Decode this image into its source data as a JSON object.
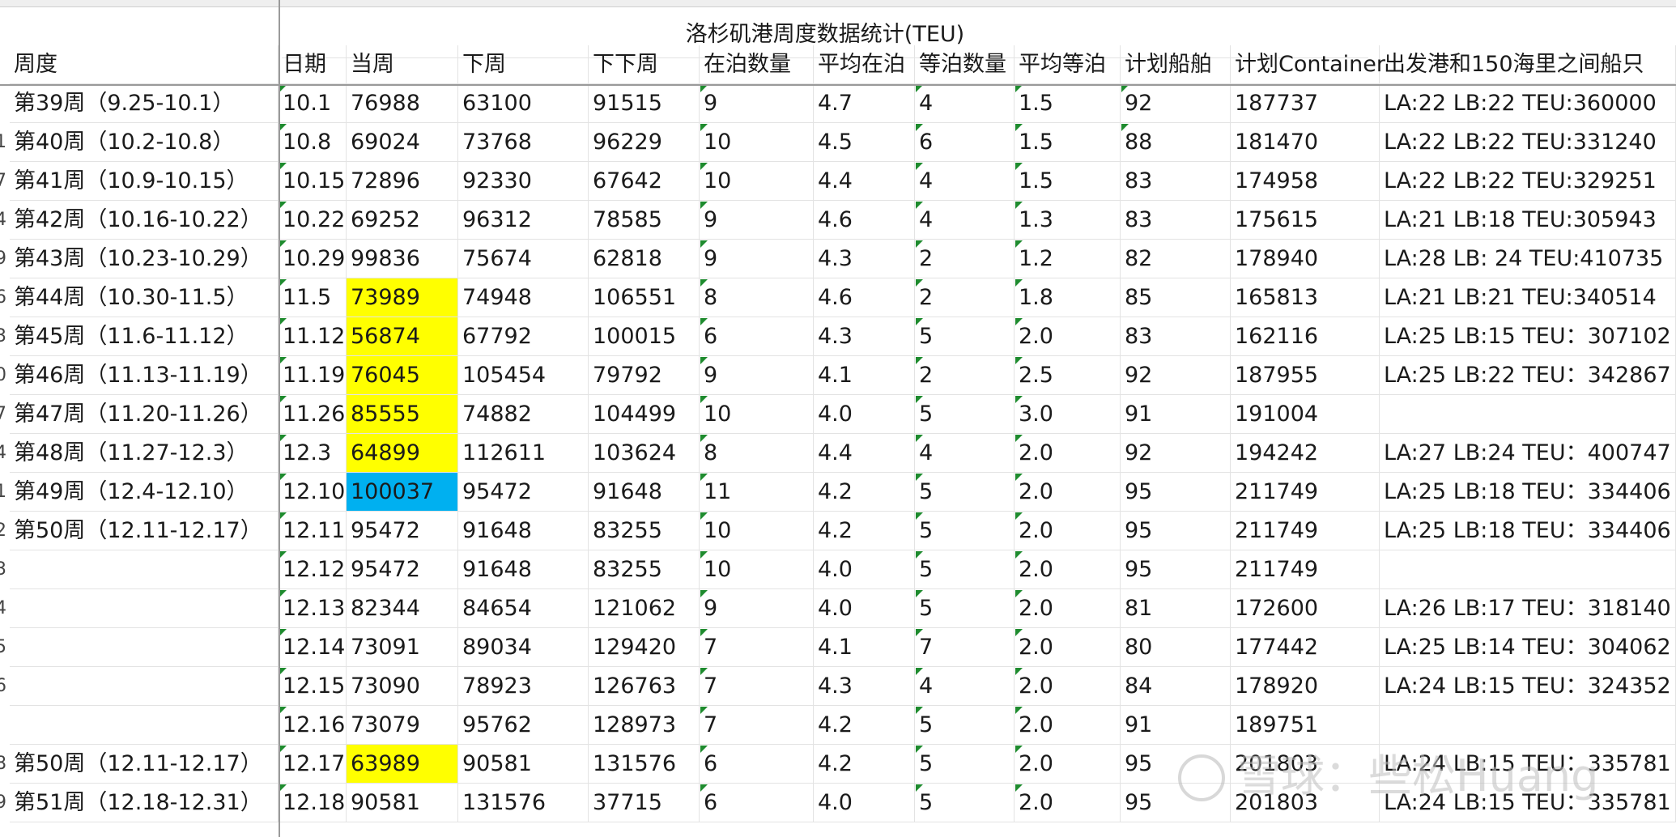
{
  "sheet": {
    "title": "洛杉矶港周度数据统计(TEU)",
    "headers": [
      "周度",
      "日期",
      "当周",
      "下周",
      "下下周",
      "在泊数量",
      "平均在泊",
      "等泊数量",
      "平均等泊",
      "计划船舶",
      "计划Container",
      "出发港和150海里之间船只"
    ],
    "row_number_stubs": [
      "",
      "1",
      "7",
      "4",
      "9",
      "6",
      "3",
      "0",
      "7",
      "4",
      "1",
      "2",
      "3",
      "4",
      "5",
      "6",
      "",
      "8",
      "9"
    ],
    "rows": [
      [
        "第39周（9.25-10.1）",
        "10.1",
        "76988",
        "63100",
        "91515",
        "9",
        "4.7",
        "4",
        "1.5",
        "92",
        "187737",
        "LA:22  LB:22  TEU:360000"
      ],
      [
        "第40周（10.2-10.8）",
        "10.8",
        "69024",
        "73768",
        "96229",
        "10",
        "4.5",
        "6",
        "1.5",
        "88",
        "181470",
        "LA:22  LB:22  TEU:331240"
      ],
      [
        "第41周（10.9-10.15）",
        "10.15",
        "72896",
        "92330",
        "67642",
        "10",
        "4.4",
        "4",
        "1.5",
        "83",
        "174958",
        "LA:22  LB:22  TEU:329251"
      ],
      [
        "第42周（10.16-10.22）",
        "10.22",
        "69252",
        "96312",
        "78585",
        "9",
        "4.6",
        "4",
        "1.3",
        "83",
        "175615",
        "LA:21 LB:18  TEU:305943"
      ],
      [
        "第43周（10.23-10.29）",
        "10.29",
        "99836",
        "75674",
        "62818",
        "9",
        "4.3",
        "2",
        "1.2",
        "82",
        "178940",
        "LA:28  LB: 24  TEU:410735"
      ],
      [
        "第44周（10.30-11.5）",
        "11.5",
        "73989",
        "74948",
        "106551",
        "8",
        "4.6",
        "2",
        "1.8",
        "85",
        "165813",
        "LA:21  LB:21  TEU:340514"
      ],
      [
        "第45周（11.6-11.12）",
        "11.12",
        "56874",
        "67792",
        "100015",
        "6",
        "4.3",
        "5",
        "2.0",
        "83",
        "162116",
        "LA:25 LB:15 TEU：307102"
      ],
      [
        "第46周（11.13-11.19）",
        "11.19",
        "76045",
        "105454",
        "79792",
        "9",
        "4.1",
        "2",
        "2.5",
        "92",
        "187955",
        "LA:25 LB:22 TEU：342867"
      ],
      [
        "第47周（11.20-11.26）",
        "11.26",
        "85555",
        "74882",
        "104499",
        "10",
        "4.0",
        "5",
        "3.0",
        "91",
        "191004",
        ""
      ],
      [
        "第48周（11.27-12.3）",
        "12.3",
        "64899",
        "112611",
        "103624",
        "8",
        "4.4",
        "4",
        "2.0",
        "92",
        "194242",
        "LA:27 LB:24 TEU：400747"
      ],
      [
        "第49周（12.4-12.10）",
        "12.10",
        "100037",
        "95472",
        "91648",
        "11",
        "4.2",
        "5",
        "2.0",
        "95",
        "211749",
        "LA:25 LB:18 TEU：334406"
      ],
      [
        "第50周（12.11-12.17）",
        "12.11",
        "95472",
        "91648",
        "83255",
        "10",
        "4.2",
        "5",
        "2.0",
        "95",
        "211749",
        "LA:25 LB:18 TEU：334406"
      ],
      [
        "",
        "12.12",
        "95472",
        "91648",
        "83255",
        "10",
        "4.0",
        "5",
        "2.0",
        "95",
        "211749",
        ""
      ],
      [
        "",
        "12.13",
        "82344",
        "84654",
        "121062",
        "9",
        "4.0",
        "5",
        "2.0",
        "81",
        "172600",
        "LA:26 LB:17 TEU：318140"
      ],
      [
        "",
        "12.14",
        "73091",
        "89034",
        "129420",
        "7",
        "4.1",
        "7",
        "2.0",
        "80",
        "177442",
        "LA:25 LB:14 TEU：304062"
      ],
      [
        "",
        "12.15",
        "73090",
        "78923",
        "126763",
        "7",
        "4.3",
        "4",
        "2.0",
        "84",
        "178920",
        "LA:24 LB:15 TEU：324352"
      ],
      [
        "",
        "12.16",
        "73079",
        "95762",
        "128973",
        "7",
        "4.2",
        "5",
        "2.0",
        "91",
        "189751",
        ""
      ],
      [
        "第50周（12.11-12.17）",
        "12.17",
        "63989",
        "90581",
        "131576",
        "6",
        "4.2",
        "5",
        "2.0",
        "95",
        "201803",
        "LA:24 LB:15 TEU：335781"
      ],
      [
        "第51周（12.18-12.31）",
        "12.18",
        "90581",
        "131576",
        "37715",
        "6",
        "4.0",
        "5",
        "2.0",
        "95",
        "201803",
        "LA:24 LB:15 TEU：335781"
      ]
    ],
    "highlights": {
      "yellow_current_week_rows": [
        5,
        6,
        7,
        8,
        9,
        17
      ],
      "blue_current_week_rows": [
        10
      ]
    },
    "colors": {
      "yellow": "#ffff00",
      "blue": "#00b0f0",
      "comment_marker": "#1e8b2e",
      "grid": "#e3e3e3"
    }
  },
  "watermark": {
    "icon": "xueqiu-logo-icon",
    "text": "雪球：些松Huang"
  }
}
